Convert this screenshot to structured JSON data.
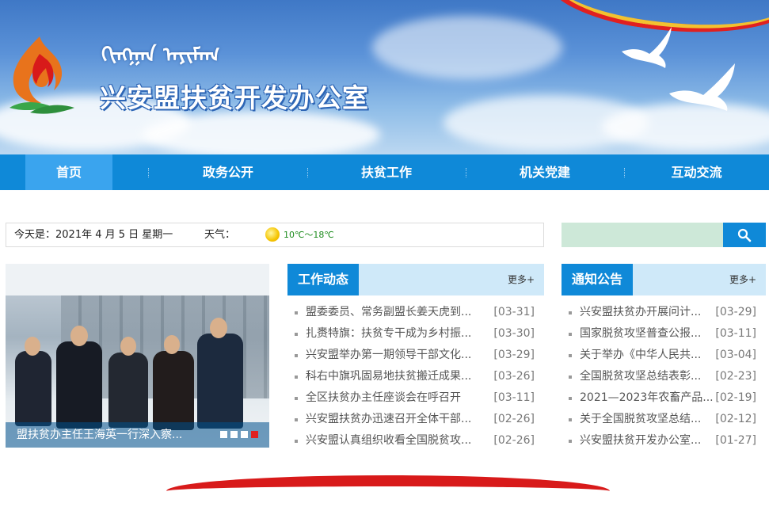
{
  "header": {
    "mongolian_title": "ᠬᠢᠩᠭᠠᠨ ᠠᠶᠢᠮᠠᠭ",
    "title": "兴安盟扶贫开发办公室"
  },
  "nav": {
    "items": [
      {
        "label": "首页",
        "active": true
      },
      {
        "label": "政务公开",
        "active": false
      },
      {
        "label": "扶贫工作",
        "active": false
      },
      {
        "label": "机关党建",
        "active": false
      },
      {
        "label": "互动交流",
        "active": false
      }
    ]
  },
  "datebar": {
    "date_text": "今天是：2021年 4 月 5 日 星期一",
    "weather_label": "天气：",
    "weather_icon": "sun-icon",
    "temperature": "10℃～18℃"
  },
  "search": {
    "value": "",
    "button_icon": "search-icon"
  },
  "slideshow": {
    "caption": "盟扶贫办主任王海英一行深入察...",
    "total_slides": 4,
    "active_slide": 4
  },
  "work_news": {
    "title": "工作动态",
    "more_label": "更多+",
    "items": [
      {
        "title": "盟委委员、常务副盟长姜天虎到...",
        "date": "[03-31]"
      },
      {
        "title": "扎赉特旗：扶贫专干成为乡村振...",
        "date": "[03-30]"
      },
      {
        "title": "兴安盟举办第一期领导干部文化...",
        "date": "[03-29]"
      },
      {
        "title": "科右中旗巩固易地扶贫搬迁成果...",
        "date": "[03-26]"
      },
      {
        "title": "全区扶贫办主任座谈会在呼召开",
        "date": "[03-11]"
      },
      {
        "title": "兴安盟扶贫办迅速召开全体干部...",
        "date": "[02-26]"
      },
      {
        "title": "兴安盟认真组织收看全国脱贫攻...",
        "date": "[02-26]"
      }
    ]
  },
  "notices": {
    "title": "通知公告",
    "more_label": "更多+",
    "items": [
      {
        "title": "兴安盟扶贫办开展问计...",
        "date": "[03-29]"
      },
      {
        "title": "国家脱贫攻坚普查公报...",
        "date": "[03-11]"
      },
      {
        "title": "关于举办《中华人民共...",
        "date": "[03-04]"
      },
      {
        "title": "全国脱贫攻坚总结表彰...",
        "date": "[02-23]"
      },
      {
        "title": "2021—2023年农畜产品...",
        "date": "[02-19]"
      },
      {
        "title": "关于全国脱贫攻坚总结...",
        "date": "[02-12]"
      },
      {
        "title": "兴安盟扶贫开发办公室...",
        "date": "[01-27]"
      }
    ]
  },
  "colors": {
    "nav_bg": "#0f89d8",
    "nav_active": "#3aa4ee",
    "panel_head_bg": "#cfe9f9",
    "accent_red": "#e02020"
  }
}
